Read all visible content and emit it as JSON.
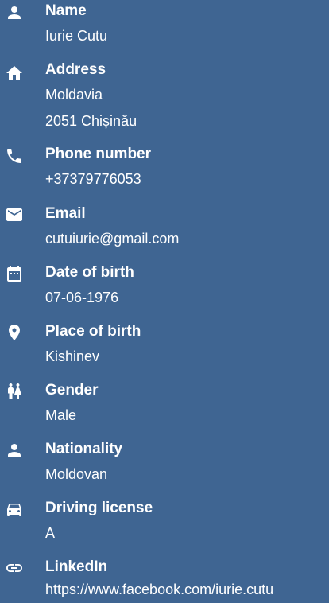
{
  "background_color": "#3f6592",
  "text_color": "#ffffff",
  "fields": [
    {
      "icon": "person-icon",
      "label": "Name",
      "lines": [
        "Iurie Cutu"
      ]
    },
    {
      "icon": "home-icon",
      "label": "Address",
      "lines": [
        "Moldavia",
        "2051 Chișinău"
      ]
    },
    {
      "icon": "phone-icon",
      "label": "Phone number",
      "lines": [
        "+37379776053"
      ]
    },
    {
      "icon": "email-icon",
      "label": "Email",
      "lines": [
        "cutuiurie@gmail.com"
      ]
    },
    {
      "icon": "calendar-icon",
      "label": "Date of birth",
      "lines": [
        "07-06-1976"
      ]
    },
    {
      "icon": "location-pin-icon",
      "label": "Place of birth",
      "lines": [
        "Kishinev"
      ]
    },
    {
      "icon": "gender-icon",
      "label": "Gender",
      "lines": [
        "Male"
      ]
    },
    {
      "icon": "person-icon",
      "label": "Nationality",
      "lines": [
        "Moldovan"
      ]
    },
    {
      "icon": "car-icon",
      "label": "Driving license",
      "lines": [
        "A"
      ]
    },
    {
      "icon": "link-icon",
      "label": "LinkedIn",
      "lines": [
        "https://www.facebook.com/iurie.cutu"
      ]
    }
  ]
}
